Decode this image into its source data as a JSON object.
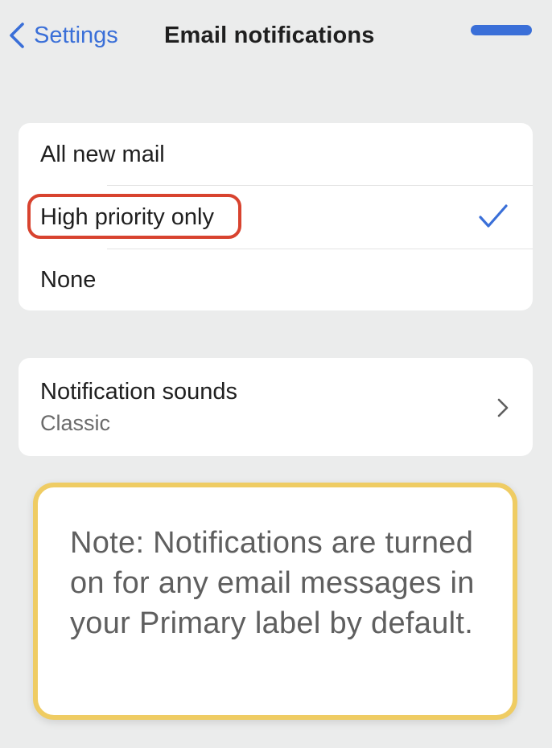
{
  "header": {
    "back_label": "Settings",
    "title": "Email notifications"
  },
  "notification_options": {
    "items": [
      {
        "label": "All new mail"
      },
      {
        "label": "High priority only",
        "selected": true,
        "highlighted": true
      },
      {
        "label": "None"
      }
    ]
  },
  "sounds": {
    "title": "Notification sounds",
    "value": "Classic"
  },
  "note": {
    "text": "Note: Notifications are turned on for any email messages in your Primary label by default."
  },
  "colors": {
    "accent": "#3a6fd8",
    "highlight_ring": "#d8432f",
    "note_border": "#efcc63",
    "background": "#ebecec"
  },
  "icons": [
    "chevron-left-icon",
    "checkmark-icon",
    "chevron-right-icon"
  ]
}
